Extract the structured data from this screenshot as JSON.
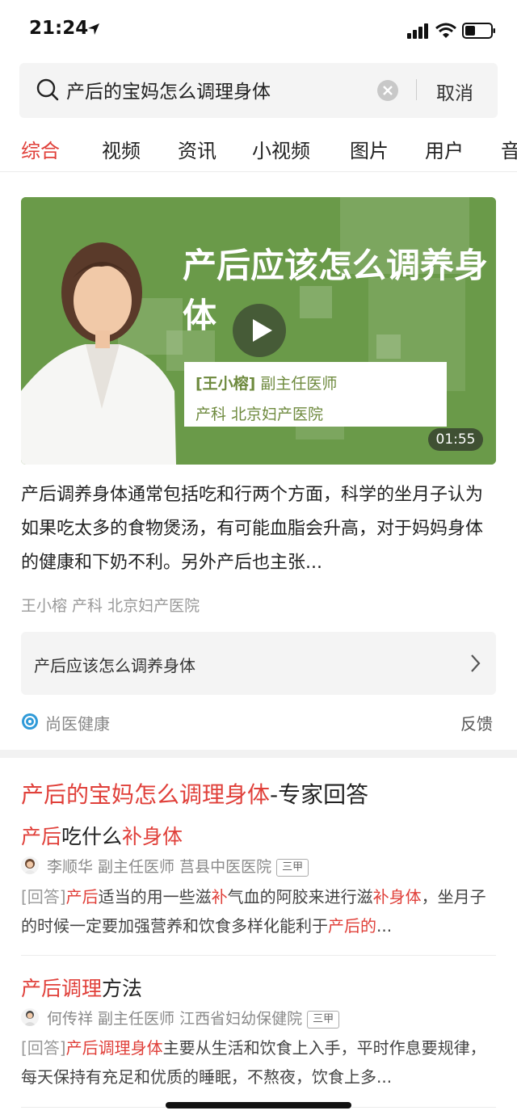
{
  "status_bar": {
    "time": "21:24"
  },
  "search": {
    "query": "产后的宝妈怎么调理身体",
    "cancel": "取消"
  },
  "tabs": [
    {
      "label": "综合",
      "active": true
    },
    {
      "label": "视频"
    },
    {
      "label": "资讯"
    },
    {
      "label": "小视频"
    },
    {
      "label": "图片"
    },
    {
      "label": "用户"
    },
    {
      "label": "音"
    }
  ],
  "video_card": {
    "title": "产后应该怎么调养身体",
    "doctor_name": "[王小榕]",
    "doctor_title": "副主任医师",
    "doctor_hospital": "产科 北京妇产医院",
    "duration": "01:55",
    "summary": "产后调养身体通常包括吃和行两个方面，科学的坐月子认为如果吃太多的食物煲汤，有可能血脂会升高，对于妈妈身体的健康和下奶不利。另外产后也主张...",
    "source_line": "王小榕 产科 北京妇产医院",
    "link_text": "产后应该怎么调养身体",
    "brand": "尚医健康",
    "feedback": "反馈"
  },
  "expert": {
    "title_highlight": "产后的宝妈怎么调理身体",
    "title_rest": "-专家回答",
    "items": [
      {
        "q_parts": [
          "产后",
          "吃什么",
          "补身体"
        ],
        "doctor": "李顺华 副主任医师 莒县中医医院",
        "badge": "三甲",
        "tag": "[回答]",
        "answer_parts": [
          "产后",
          "适当的用一些滋",
          "补",
          "气血的阿胶来进行滋",
          "补身体",
          "，坐月子的时候一定要加强营养和饮食多样化能利于",
          "产后的",
          "..."
        ]
      },
      {
        "q_parts": [
          "产后调理",
          "方法"
        ],
        "doctor": "何传祥 副主任医师 江西省妇幼保健院",
        "badge": "三甲",
        "tag": "[回答]",
        "answer_parts": [
          "产后调理身体",
          "主要从生活和饮食上入手，平时作息要规律，每天保持有充足和优质的睡眠，不熬夜，饮食上多..."
        ]
      }
    ]
  },
  "colors": {
    "accent_red": "#e0403a",
    "video_green": "#6a9a49",
    "doc_green": "#6e8a3e"
  }
}
